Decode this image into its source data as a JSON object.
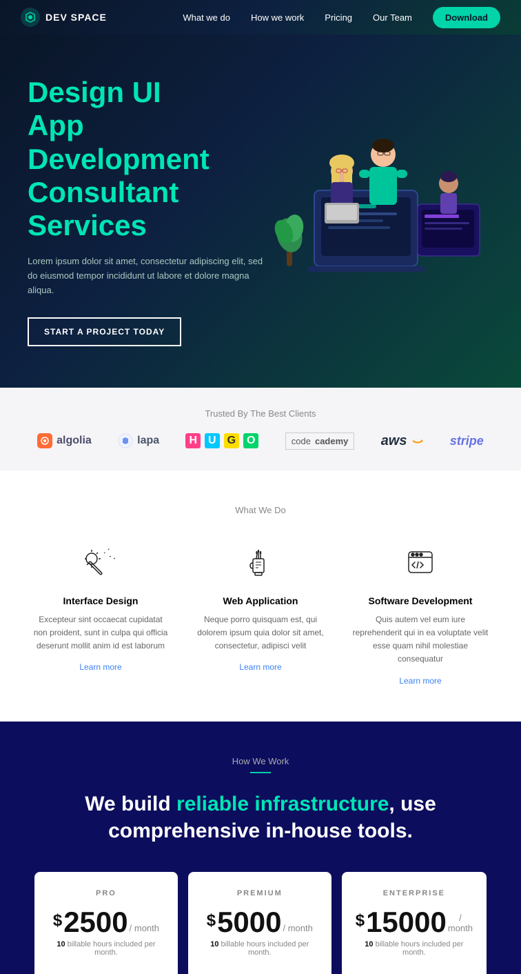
{
  "nav": {
    "logo_text": "DEV SPACE",
    "links": [
      {
        "label": "What we do",
        "href": "#"
      },
      {
        "label": "How we work",
        "href": "#"
      },
      {
        "label": "Pricing",
        "href": "#"
      },
      {
        "label": "Our Team",
        "href": "#"
      }
    ],
    "cta_label": "Download"
  },
  "hero": {
    "title_line1": "Design UI",
    "title_line2": "App Development",
    "title_line3": "Consultant Services",
    "description": "Lorem ipsum dolor sit amet, consectetur adipiscing elit, sed do eiusmod tempor incididunt ut labore et dolore magna aliqua.",
    "cta_label": "START A PROJECT TODAY"
  },
  "clients": {
    "label": "Trusted By The Best Clients",
    "logos": [
      "algolia",
      "lapa",
      "HUGO",
      "Codecademy",
      "aws",
      "stripe"
    ]
  },
  "what_we_do": {
    "section_label": "What We Do",
    "services": [
      {
        "title": "Interface Design",
        "description": "Excepteur sint occaecat cupidatat non proident, sunt in culpa qui officia deserunt mollit anim id est laborum",
        "link": "Learn more"
      },
      {
        "title": "Web Application",
        "description": "Neque porro quisquam est, qui dolorem ipsum quia dolor sit amet, consectetur, adipisci velit",
        "link": "Learn more"
      },
      {
        "title": "Software Development",
        "description": "Quis autem vel eum iure reprehenderit qui in ea voluptate velit esse quam nihil molestiae consequatur",
        "link": "Learn more"
      }
    ]
  },
  "how_we_work": {
    "section_label": "How We Work",
    "title_part1": "We build ",
    "title_highlight": "reliable infrastructure",
    "title_part2": ", use comprehensive in-house tools.",
    "plans": [
      {
        "name": "PRO",
        "price": "2500",
        "period": "/ month",
        "hours_label": "10 billable hours included per month."
      },
      {
        "name": "PREMIUM",
        "price": "5000",
        "period": "/ month",
        "hours_label": "10 billable hours included per month."
      },
      {
        "name": "ENTERPRISE",
        "price": "15000",
        "period": "/ month",
        "hours_label": "10 billable hours included per month."
      }
    ]
  }
}
